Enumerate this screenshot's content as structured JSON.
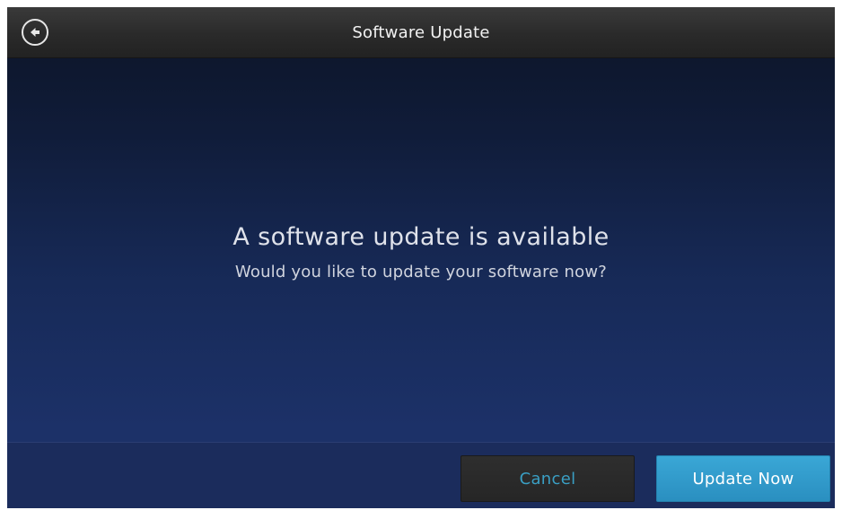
{
  "header": {
    "title": "Software Update",
    "back_icon": "back-arrow-circle-icon"
  },
  "message": {
    "headline": "A software update is available",
    "subline": "Would you like to update your software now?"
  },
  "footer": {
    "cancel_label": "Cancel",
    "update_label": "Update Now"
  },
  "colors": {
    "accent": "#3aa7d6",
    "cancel_text": "#3a9fc4",
    "background": "#172a58"
  }
}
